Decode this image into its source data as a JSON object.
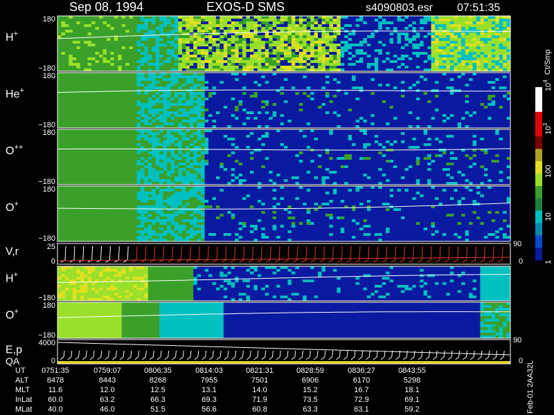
{
  "header": {
    "date": "Sep 08, 1994",
    "instrument": "EXOS-D SMS",
    "file": "s4090803.esr",
    "time": "07:51:35"
  },
  "footer_id": "Feb-01 2AA32L",
  "colors": {
    "background": "#000000",
    "low": "#0a1aa0",
    "mid": "#00c0c0",
    "green": "#3aa02a",
    "high_green": "#9ae02a",
    "yellow": "#e0e020",
    "red": "#e00000",
    "trace": "#ffffff",
    "velocity_trace": "#e03a2a",
    "qa_bar": "#e0d020"
  },
  "chart_data": {
    "type": "heatmap",
    "panels": [
      {
        "id": "h-plus-top",
        "label": "H",
        "sup": "+",
        "ymax": "180",
        "ymin": "−180",
        "profile": "h"
      },
      {
        "id": "he-plus",
        "label": "He",
        "sup": "+",
        "ymax": "180",
        "ymin": "−180",
        "profile": "he"
      },
      {
        "id": "o-plusplus",
        "label": "O",
        "sup": "++",
        "ymax": "180",
        "ymin": "−180",
        "profile": "opp"
      },
      {
        "id": "o-plus-top",
        "label": "O",
        "sup": "+",
        "ymax": "180",
        "ymin": "−180",
        "profile": "op"
      },
      {
        "id": "velocity",
        "label": "V,r",
        "sup": "",
        "ymax": "25",
        "ymin": "0",
        "profile": "vr",
        "right_top": "90",
        "right_bottom": "0"
      },
      {
        "id": "h-plus-lower",
        "label": "H",
        "sup": "+",
        "ymax": "",
        "ymin": "−180",
        "profile": "h2"
      },
      {
        "id": "o-plus-lower",
        "label": "O",
        "sup": "+",
        "ymax": "180",
        "ymin": "−180",
        "profile": "o2"
      },
      {
        "id": "energy-qa",
        "label": "E,p",
        "label2": "QA",
        "sup": "",
        "ymax": "4000",
        "ymin": "0",
        "profile": "ep",
        "right_top": "90",
        "right_bottom": "0"
      }
    ],
    "colorbar": {
      "unit": "Ct/Smp",
      "scale": "log",
      "range": [
        1,
        10000
      ],
      "tick_labels": [
        {
          "base": "10",
          "exp": "4",
          "value": 10000
        },
        {
          "base": "10",
          "exp": "3",
          "value": 1000
        },
        {
          "base": "100",
          "exp": "",
          "value": 100
        },
        {
          "base": "10",
          "exp": "",
          "value": 10
        },
        {
          "base": "1",
          "exp": "",
          "value": 1
        }
      ]
    },
    "x_table": {
      "rows": [
        {
          "label": "UT",
          "values": [
            "0751:35",
            "0759:07",
            "0806:35",
            "0814:03",
            "0821:31",
            "0828:59",
            "0836:27",
            "0843:55"
          ]
        },
        {
          "label": "ALT",
          "values": [
            "8478",
            "8443",
            "8268",
            "7955",
            "7501",
            "6906",
            "6170",
            "5298"
          ]
        },
        {
          "label": "MLT",
          "values": [
            "11.6",
            "12.0",
            "12.5",
            "13.1",
            "14.0",
            "15.2",
            "16.7",
            "18.1"
          ]
        },
        {
          "label": "InLat",
          "values": [
            "60.0",
            "63.2",
            "66.3",
            "69.3",
            "71.9",
            "73.5",
            "72.9",
            "69.1"
          ]
        },
        {
          "label": "MLat",
          "values": [
            "40.0",
            "46.0",
            "51.5",
            "56.6",
            "60.8",
            "63.3",
            "63.1",
            "59.2"
          ]
        }
      ]
    }
  }
}
